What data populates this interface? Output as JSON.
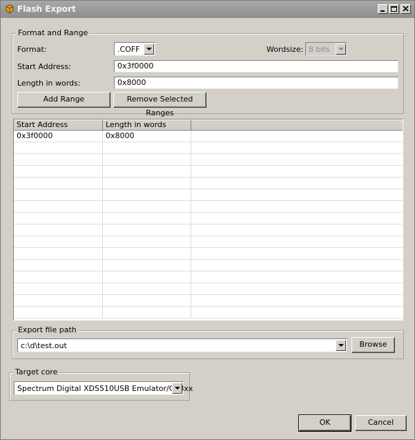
{
  "window": {
    "title": "Flash Export"
  },
  "format_range": {
    "legend": "Format and Range",
    "format_label": "Format:",
    "format_value": ".COFF",
    "wordsize_label": "Wordsize:",
    "wordsize_value": "8 bits",
    "start_label": "Start Address:",
    "start_value": "0x3f0000",
    "length_label": "Length in words:",
    "length_value": "0x8000",
    "add_button": "Add Range",
    "remove_button": "Remove Selected Ranges"
  },
  "ranges_table": {
    "columns": [
      "Start Address",
      "Length in words",
      ""
    ],
    "rows": [
      [
        "0x3f0000",
        "0x8000",
        ""
      ],
      [
        "",
        "",
        ""
      ],
      [
        "",
        "",
        ""
      ],
      [
        "",
        "",
        ""
      ],
      [
        "",
        "",
        ""
      ],
      [
        "",
        "",
        ""
      ],
      [
        "",
        "",
        ""
      ],
      [
        "",
        "",
        ""
      ],
      [
        "",
        "",
        ""
      ],
      [
        "",
        "",
        ""
      ],
      [
        "",
        "",
        ""
      ],
      [
        "",
        "",
        ""
      ],
      [
        "",
        "",
        ""
      ],
      [
        "",
        "",
        ""
      ],
      [
        "",
        "",
        ""
      ],
      [
        "",
        "",
        ""
      ]
    ]
  },
  "export": {
    "legend": "Export file path",
    "path_value": "c:\\d\\test.out",
    "browse_button": "Browse"
  },
  "target": {
    "legend": "Target core",
    "core_value": "Spectrum Digital XDS510USB Emulator/C28xx"
  },
  "footer": {
    "ok_button": "OK",
    "cancel_button": "Cancel"
  },
  "icons": {
    "app": "app-icon",
    "minimize": "minimize-icon",
    "maximize": "maximize-icon",
    "close": "close-icon",
    "dropdown": "chevron-down-icon"
  }
}
